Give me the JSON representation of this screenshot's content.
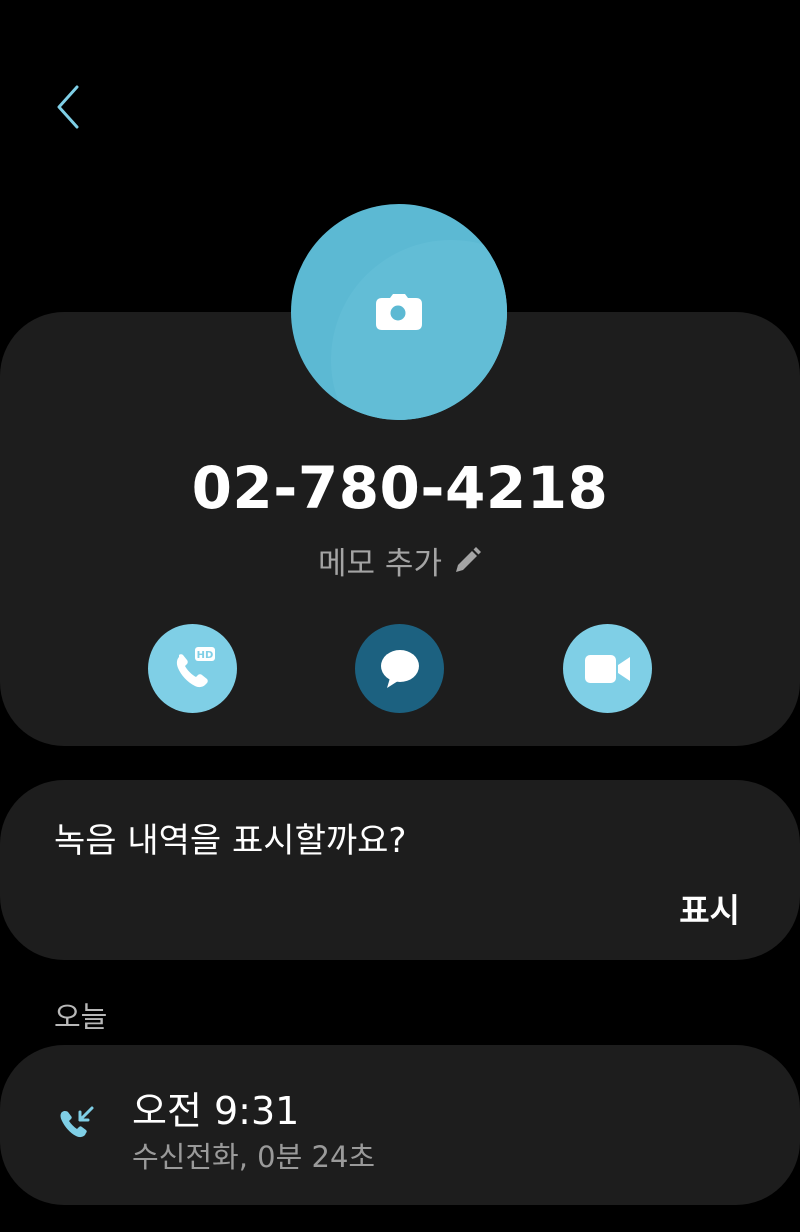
{
  "header": {
    "back_icon": "chevron-left-icon"
  },
  "contact": {
    "avatar_icon": "camera-icon",
    "phone_number": "02-780-4218",
    "memo_label": "메모 추가",
    "memo_icon": "pencil-icon"
  },
  "actions": [
    {
      "name": "hd-voice-call",
      "icon": "phone-hd-icon"
    },
    {
      "name": "message",
      "icon": "chat-bubble-icon"
    },
    {
      "name": "video-call",
      "icon": "video-camera-icon"
    }
  ],
  "recording": {
    "question": "녹음 내역을 표시할까요?",
    "show_label": "표시"
  },
  "history": {
    "section_label": "오늘",
    "entries": [
      {
        "icon": "incoming-call-icon",
        "time": "오전 9:31",
        "detail": "수신전화, 0분 24초"
      }
    ]
  },
  "colors": {
    "background": "#000000",
    "card": "#1d1d1d",
    "accent": "#5cb9d3",
    "action_light": "#7fcfe6",
    "action_dark": "#1c6180"
  }
}
